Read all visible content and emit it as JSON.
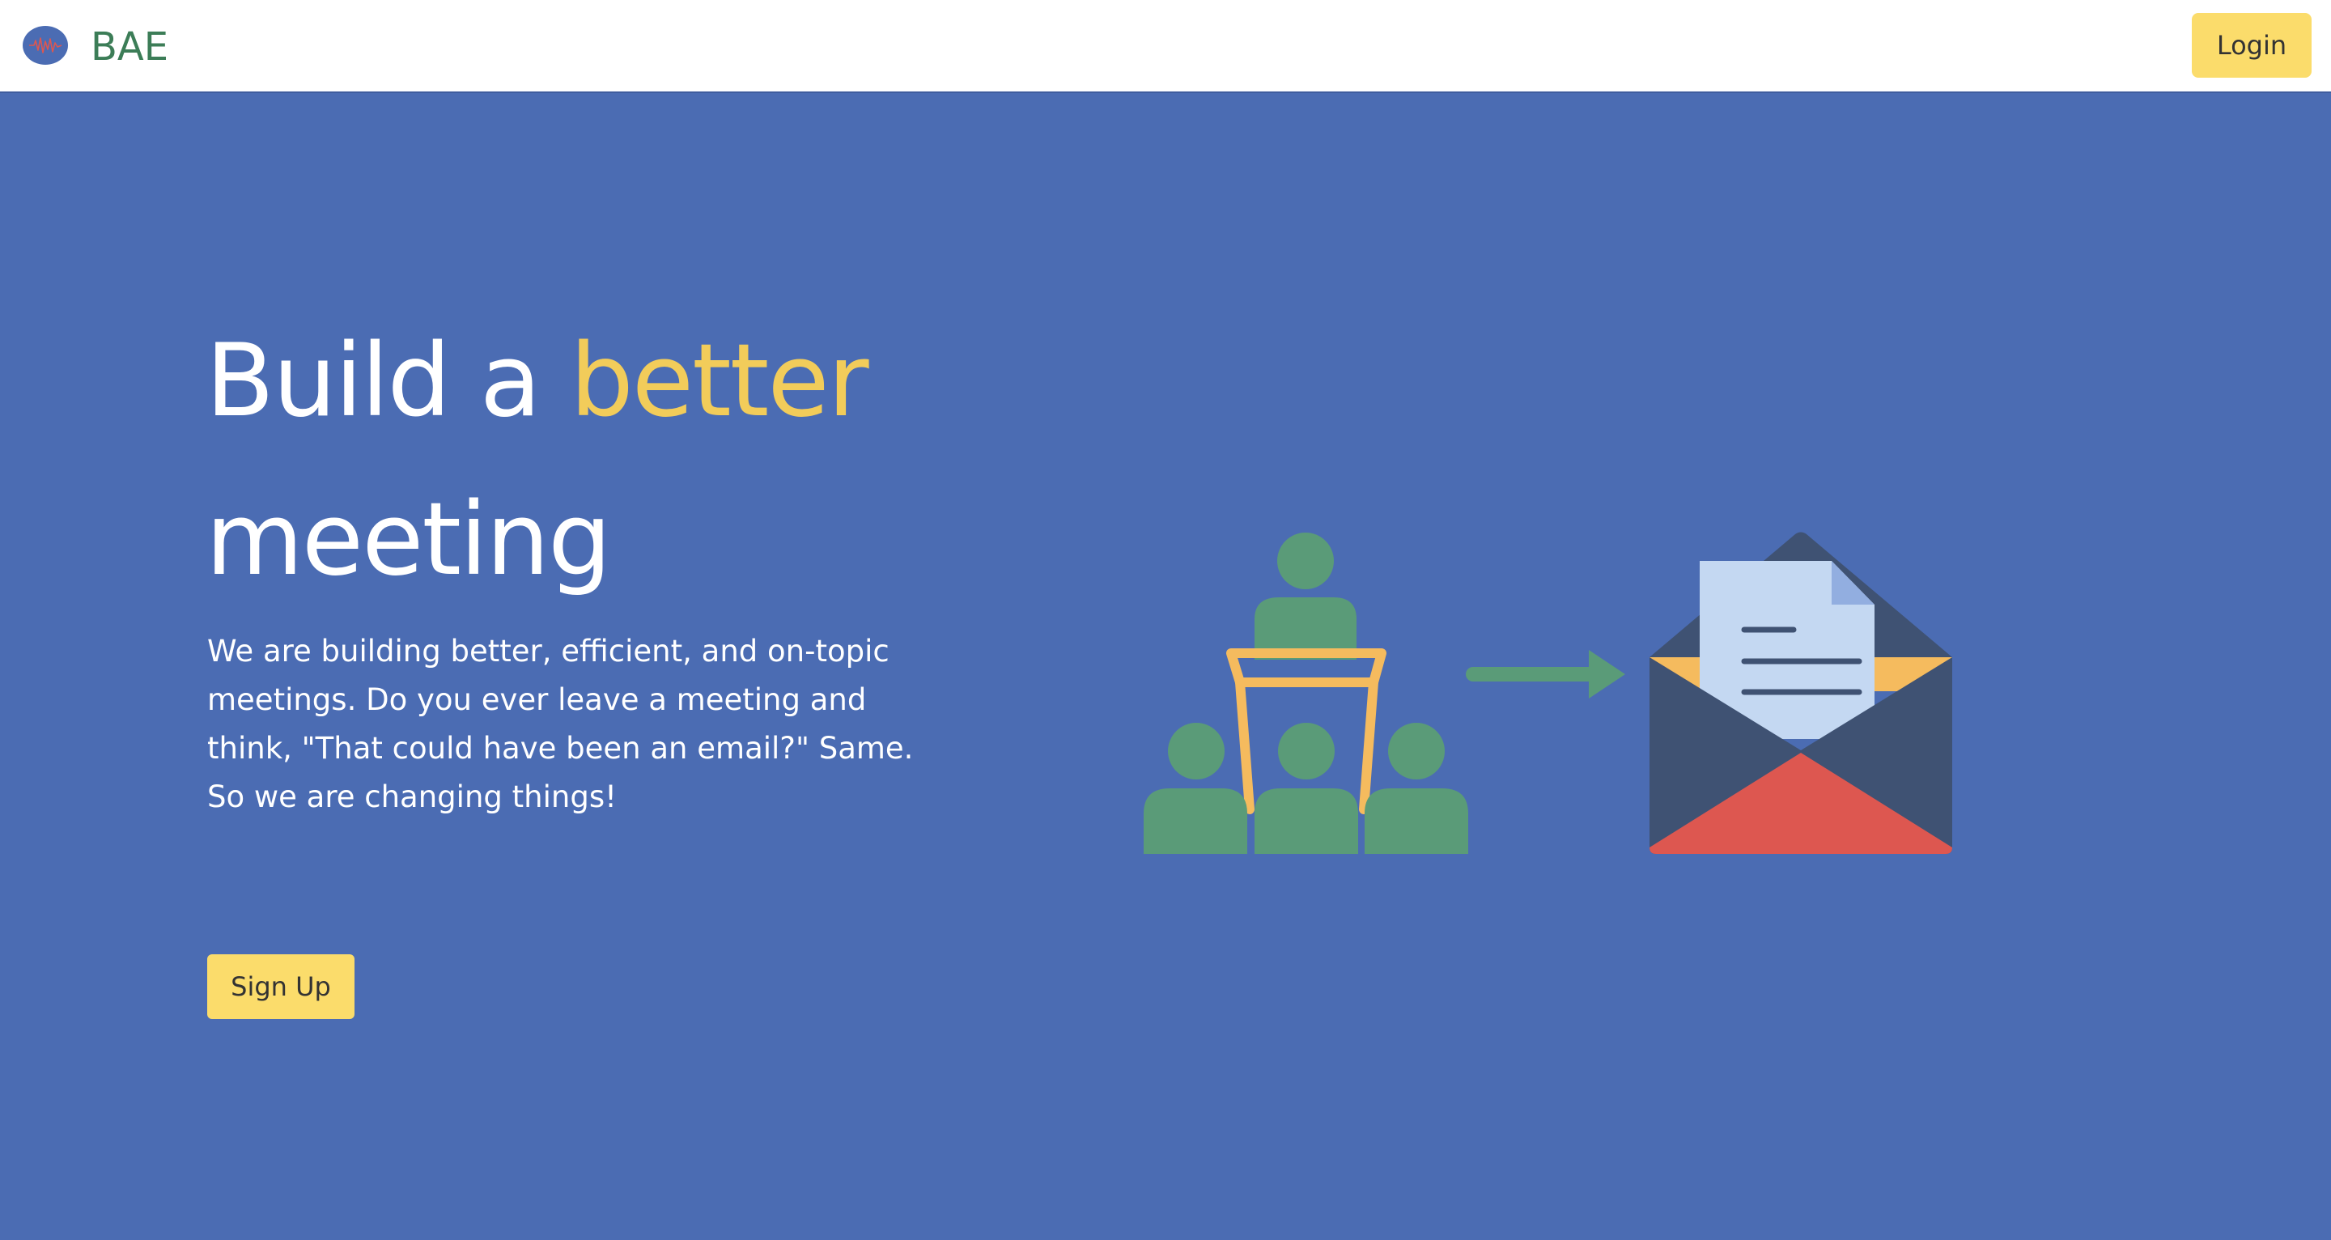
{
  "navbar": {
    "brand": "BAE",
    "logo_icon": "sound-wave-logo-icon",
    "login_label": "Login"
  },
  "hero": {
    "headline_part1": "Build a ",
    "headline_accent": "better",
    "headline_part2": "meeting",
    "description": "We are building better, efficient, and on-topic meetings. Do you ever leave a meeting and think, \"That could have been an email?\" Same. So we are changing things!",
    "signup_label": "Sign Up",
    "illustration_icons": [
      "presentation-audience-icon",
      "arrow-right-icon",
      "open-envelope-letter-icon"
    ]
  },
  "colors": {
    "hero_background": "#4b6cb3",
    "accent_yellow": "#f2cc5a",
    "button_yellow": "#fbdc6b",
    "brand_green": "#3c7d57",
    "figure_green": "#5a9b78",
    "podium_orange": "#f5bb5e",
    "envelope_dark": "#3f5273",
    "envelope_red": "#dd5750",
    "paper_light": "#c4d8f2"
  }
}
